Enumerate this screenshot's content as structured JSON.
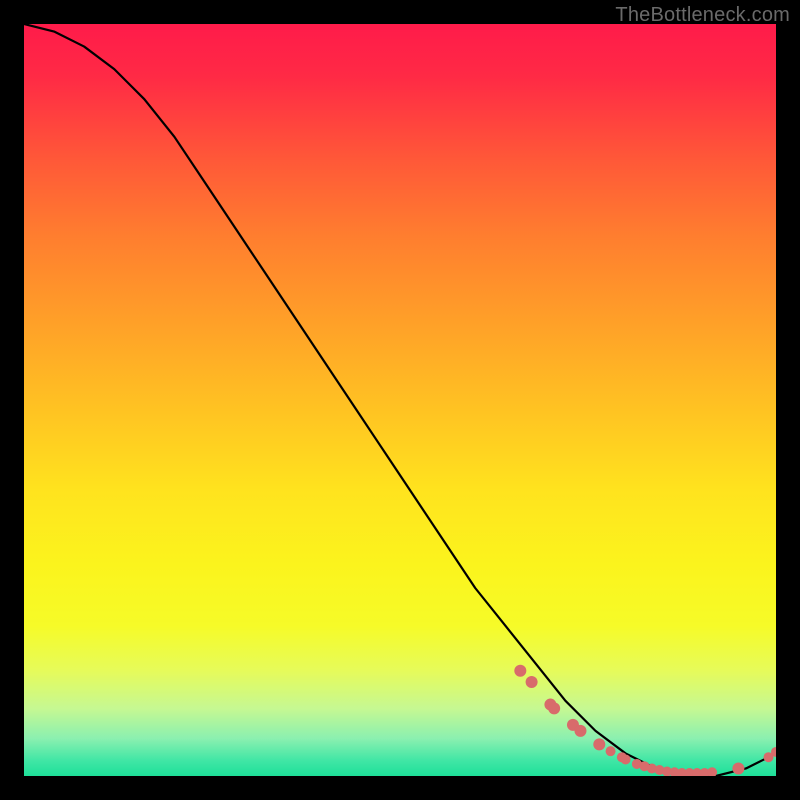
{
  "watermark": "TheBottleneck.com",
  "chart_data": {
    "type": "line",
    "title": "",
    "xlabel": "",
    "ylabel": "",
    "xlim": [
      0,
      100
    ],
    "ylim": [
      0,
      100
    ],
    "grid": false,
    "legend": false,
    "series": [
      {
        "name": "curve",
        "x": [
          0,
          4,
          8,
          12,
          16,
          20,
          24,
          28,
          32,
          36,
          40,
          44,
          48,
          52,
          56,
          60,
          64,
          68,
          72,
          76,
          80,
          84,
          88,
          92,
          96,
          100
        ],
        "y": [
          100,
          99,
          97,
          94,
          90,
          85,
          79,
          73,
          67,
          61,
          55,
          49,
          43,
          37,
          31,
          25,
          20,
          15,
          10,
          6,
          3,
          1,
          0,
          0,
          1,
          3
        ]
      }
    ],
    "markers": [
      {
        "x": 66,
        "y": 14.0,
        "r": 6
      },
      {
        "x": 67.5,
        "y": 12.5,
        "r": 6
      },
      {
        "x": 70,
        "y": 9.5,
        "r": 6
      },
      {
        "x": 70.5,
        "y": 9.0,
        "r": 6
      },
      {
        "x": 73,
        "y": 6.8,
        "r": 6
      },
      {
        "x": 74,
        "y": 6.0,
        "r": 6
      },
      {
        "x": 76.5,
        "y": 4.2,
        "r": 6
      },
      {
        "x": 78,
        "y": 3.3,
        "r": 5
      },
      {
        "x": 79.5,
        "y": 2.5,
        "r": 5
      },
      {
        "x": 80,
        "y": 2.2,
        "r": 5
      },
      {
        "x": 81.5,
        "y": 1.6,
        "r": 5
      },
      {
        "x": 82.5,
        "y": 1.3,
        "r": 5
      },
      {
        "x": 83.5,
        "y": 1.0,
        "r": 5
      },
      {
        "x": 84.5,
        "y": 0.8,
        "r": 5
      },
      {
        "x": 85.5,
        "y": 0.6,
        "r": 5
      },
      {
        "x": 86.5,
        "y": 0.5,
        "r": 5
      },
      {
        "x": 87.5,
        "y": 0.4,
        "r": 5
      },
      {
        "x": 88.5,
        "y": 0.4,
        "r": 5
      },
      {
        "x": 89.5,
        "y": 0.4,
        "r": 5
      },
      {
        "x": 90.5,
        "y": 0.4,
        "r": 5
      },
      {
        "x": 91.5,
        "y": 0.5,
        "r": 5
      },
      {
        "x": 95.0,
        "y": 1.0,
        "r": 6
      },
      {
        "x": 99.0,
        "y": 2.5,
        "r": 5
      },
      {
        "x": 100.0,
        "y": 3.2,
        "r": 5
      }
    ],
    "marker_color": "#d86b6b",
    "line_color": "#000000"
  }
}
